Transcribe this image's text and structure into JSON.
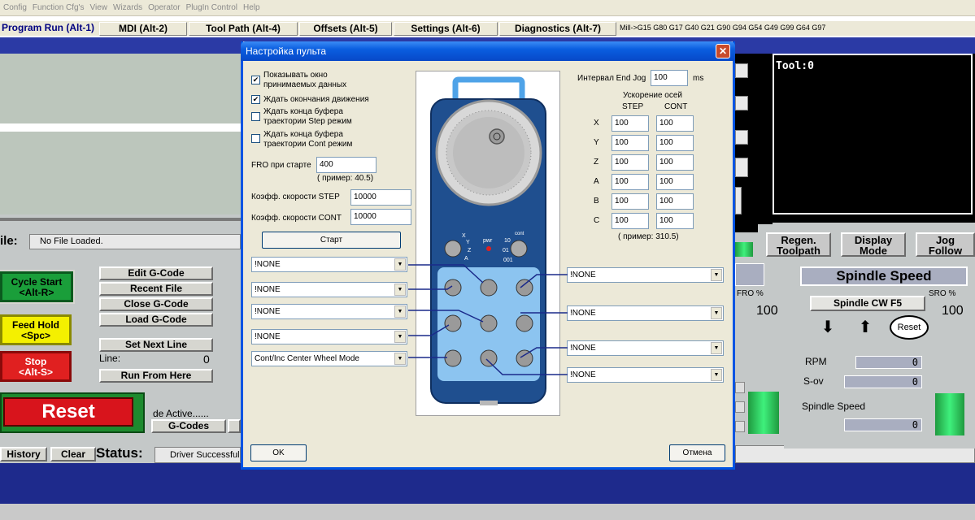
{
  "menu": [
    "Config",
    "Function Cfg's",
    "View",
    "Wizards",
    "Operator",
    "PlugIn Control",
    "Help"
  ],
  "tabs": {
    "program_run": "Program Run (Alt-1)",
    "mdi": "MDI (Alt-2)",
    "tool_path": "Tool Path (Alt-4)",
    "offsets": "Offsets (Alt-5)",
    "settings": "Settings (Alt-6)",
    "diagnostics": "Diagnostics (Alt-7)"
  },
  "gcode_line": "Mill->G15  G80 G17 G40 G21 G90 G94 G54 G49 G99 G64 G97",
  "tool_display": "Tool:0",
  "file": {
    "label": "ile:",
    "value": "No File Loaded."
  },
  "left_buttons": {
    "cycle_start": [
      "Cycle Start",
      "<Alt-R>"
    ],
    "feed_hold": [
      "Feed Hold",
      "<Spc>"
    ],
    "stop": [
      "Stop",
      "<Alt-S>"
    ],
    "reset": "Reset"
  },
  "gcode_buttons": {
    "edit": "Edit G-Code",
    "recent": "Recent File",
    "close": "Close G-Code",
    "load": "Load G-Code",
    "set_next": "Set Next Line",
    "line_label": "Line:",
    "line_value": "0",
    "run_from": "Run From Here",
    "mode_active": "de Active......",
    "gcodes": "G-Codes"
  },
  "status_bar": {
    "history": "History",
    "clear": "Clear",
    "status_label": "Status:",
    "status_value": "Driver Successful"
  },
  "right_buttons": {
    "regen": [
      "Regen.",
      "Toolpath"
    ],
    "display": [
      "Display",
      "Mode"
    ],
    "jog": [
      "Jog",
      "Follow"
    ]
  },
  "spindle": {
    "title": "Spindle Speed",
    "cw": "Spindle CW F5",
    "fro_label": "FRO %",
    "fro_value": "100",
    "sro_label": "SRO %",
    "sro_value": "100",
    "reset": "Reset",
    "rpm_label": "RPM",
    "rpm_value": "0",
    "sov_label": "S-ov",
    "sov_value": "0",
    "speed_label": "Spindle Speed",
    "speed_value": "0"
  },
  "dialog": {
    "title": "Настройка пульта",
    "checkboxes": [
      {
        "label": [
          "Показывать окно",
          "принимаемых данных"
        ],
        "checked": true
      },
      {
        "label": [
          "Ждать окончания движения"
        ],
        "checked": true
      },
      {
        "label": [
          "Ждать конца буфера",
          "траектории Step режим"
        ],
        "checked": false
      },
      {
        "label": [
          "Ждать конца буфера",
          "траектории Cont режим"
        ],
        "checked": false
      }
    ],
    "fro_start_label": "FRO при старте",
    "fro_start_value": "400",
    "fro_example": "( пример: 40.5)",
    "step_coef_label": "Коэфф. скорости STEP",
    "step_coef_value": "10000",
    "cont_coef_label": "Коэфф. скорости CONT",
    "cont_coef_value": "10000",
    "start_button": "Старт",
    "left_selects": [
      "!NONE",
      "!NONE",
      "!NONE",
      "!NONE",
      "Cont/Inc Center Wheel Mode"
    ],
    "right_selects": [
      "!NONE",
      "!NONE",
      "!NONE",
      "!NONE"
    ],
    "end_jog_label": "Интервал End Jog",
    "end_jog_value": "100",
    "end_jog_unit": "ms",
    "accel_title": "Ускорение осей",
    "step_header": "STEP",
    "cont_header": "CONT",
    "axes": [
      {
        "name": "X",
        "step": "100",
        "cont": "100"
      },
      {
        "name": "Y",
        "step": "100",
        "cont": "100"
      },
      {
        "name": "Z",
        "step": "100",
        "cont": "100"
      },
      {
        "name": "A",
        "step": "100",
        "cont": "100"
      },
      {
        "name": "B",
        "step": "100",
        "cont": "100"
      },
      {
        "name": "C",
        "step": "100",
        "cont": "100"
      }
    ],
    "accel_example": "( пример: 310.5)",
    "ok": "OK",
    "cancel": "Отмена",
    "pendant": {
      "axis_labels": [
        "X",
        "Y",
        "Z",
        "A"
      ],
      "pwr": "pwr",
      "steps": [
        "10",
        "01",
        "001"
      ],
      "cont": "cont"
    }
  },
  "colors": {
    "title_blue": "#0a5ee0",
    "pendant_blue": "#1f4f8f",
    "panel_blue": "#8cc4f0",
    "wire_blue": "#1a2a8a"
  }
}
